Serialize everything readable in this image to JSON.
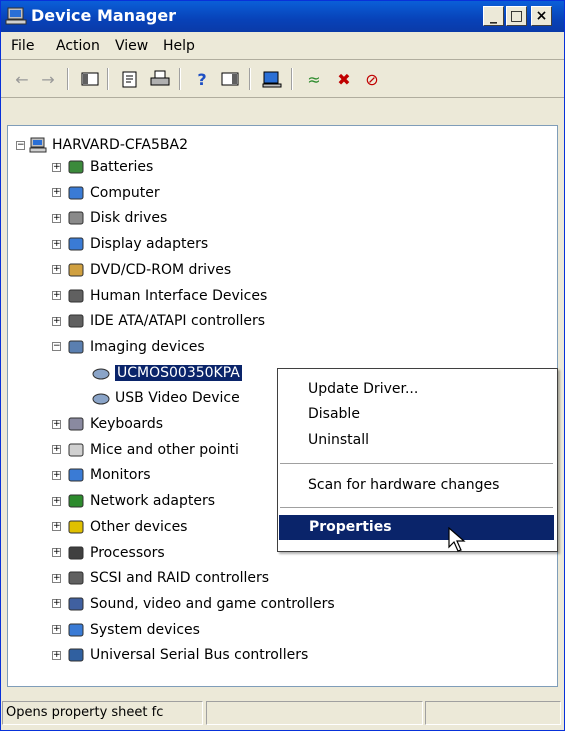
{
  "window": {
    "title": "Device Manager"
  },
  "title_buttons": {
    "minimize": "_",
    "maximize": "□",
    "close": "×"
  },
  "menu": [
    "File",
    "Action",
    "View",
    "Help"
  ],
  "tree": {
    "root": "HARVARD-CFA5BA2",
    "categories": [
      "Batteries",
      "Computer",
      "Disk drives",
      "Display adapters",
      "DVD/CD-ROM drives",
      "Human Interface Devices",
      "IDE ATA/ATAPI controllers",
      "Imaging devices",
      "Keyboards",
      "Mice and other pointi",
      "Monitors",
      "Network adapters",
      "Other devices",
      "Processors",
      "SCSI and RAID controllers",
      "Sound, video and game controllers",
      "System devices",
      "Universal Serial Bus controllers"
    ],
    "imaging_children": [
      "UCMOS00350KPA",
      "USB Video Device"
    ],
    "expander_plus": "+",
    "expander_minus": "−"
  },
  "context_menu": {
    "items": [
      "Update Driver...",
      "Disable",
      "Uninstall",
      "Scan for hardware changes",
      "Properties"
    ],
    "highlight_color": "#0a246a"
  },
  "status": {
    "text": "Opens property sheet fc"
  },
  "colors": {
    "title": "#0842b8",
    "selection": "#0a246a",
    "face": "#ece9d8"
  }
}
